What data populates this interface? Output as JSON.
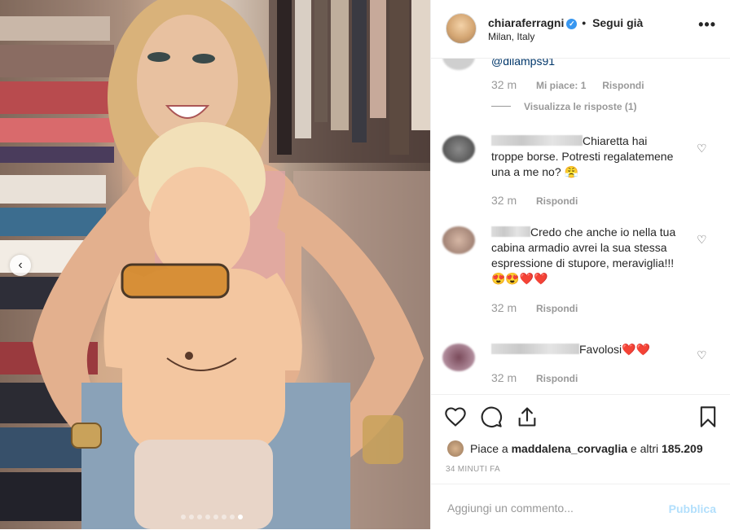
{
  "post": {
    "username": "chiaraferragni",
    "follow_label": "Segui già",
    "location": "Milan, Italy",
    "verified_mark": "✓"
  },
  "comments": [
    {
      "username_partial": "@dilamps91",
      "time": "32 m",
      "likes": "Mi piace: 1",
      "reply": "Rispondi",
      "view_replies": "Visualizza le risposte (1)"
    },
    {
      "text": "Chiaretta hai troppe borse. Potresti regalatemene una a me no? 😤",
      "time": "32 m",
      "reply": "Rispondi"
    },
    {
      "text": "Credo che anche io nella tua cabina armadio avrei la sua stessa espressione di stupore, meraviglia!!! 😍😍❤️❤️",
      "time": "32 m",
      "reply": "Rispondi"
    },
    {
      "text": "Favolosi❤️❤️",
      "time": "32 m",
      "reply": "Rispondi"
    }
  ],
  "likes": {
    "prefix": "Piace a ",
    "user": "maddalena_corvaglia",
    "middle": " e altri ",
    "count": "185.209"
  },
  "time_ago": "34 MINUTI FA",
  "add_comment": {
    "placeholder": "Aggiungi un commento...",
    "publish_label": "Pubblica"
  },
  "carousel": {
    "total": 8,
    "active": 8
  },
  "icons": [
    "heart-icon",
    "comment-icon",
    "share-icon",
    "bookmark-icon",
    "more-icon",
    "chevron-left-icon"
  ],
  "colors": {
    "verified": "#3897f0",
    "publish_disabled": "#b2dffc",
    "meta_gray": "#999999"
  }
}
